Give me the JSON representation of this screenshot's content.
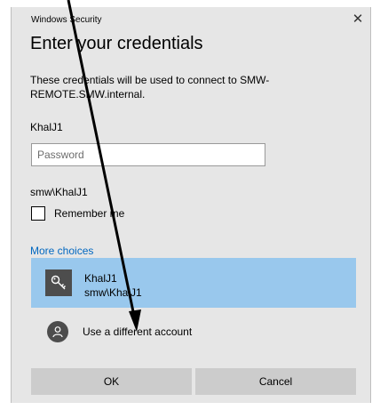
{
  "window": {
    "title": "Windows Security",
    "close_glyph": "✕"
  },
  "heading": "Enter your credentials",
  "description": "These credentials will be used to connect to SMW-REMOTE.SMW.internal.",
  "username": "KhalJ1",
  "password": {
    "value": "",
    "placeholder": "Password"
  },
  "domain_user": "smw\\KhalJ1",
  "remember": {
    "label": "Remember me",
    "checked": false
  },
  "more_choices": "More choices",
  "accounts": [
    {
      "name": "KhalJ1",
      "domain_user": "smw\\KhalJ1",
      "icon": "key-icon",
      "selected": true
    }
  ],
  "different_account": {
    "label": "Use a different account",
    "icon": "person-icon"
  },
  "buttons": {
    "ok": "OK",
    "cancel": "Cancel"
  },
  "colors": {
    "dialog_bg": "#e6e6e6",
    "selected_bg": "#99c8ed",
    "link": "#0067c0",
    "button_bg": "#cccccc",
    "icon_tile": "#4d4d4d"
  },
  "annotation": {
    "type": "arrow",
    "color": "#000000"
  }
}
